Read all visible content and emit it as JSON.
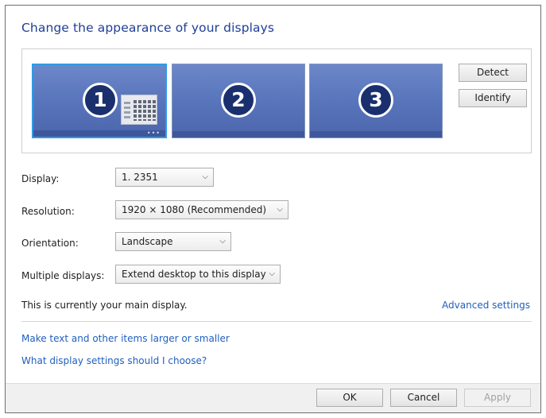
{
  "window": {
    "heading": "Change the appearance of your displays"
  },
  "monitors": [
    {
      "number": "1",
      "selected": true
    },
    {
      "number": "2",
      "selected": false
    },
    {
      "number": "3",
      "selected": false
    }
  ],
  "side_buttons": {
    "detect_label": "Detect",
    "identify_label": "Identify"
  },
  "form": {
    "display_label": "Display:",
    "display_value": "1. 2351",
    "resolution_label": "Resolution:",
    "resolution_value": "1920 × 1080 (Recommended)",
    "orientation_label": "Orientation:",
    "orientation_value": "Landscape",
    "multiple_label": "Multiple displays:",
    "multiple_value": "Extend desktop to this display"
  },
  "status": {
    "main_display_text": "This is currently your main display.",
    "advanced_link": "Advanced settings"
  },
  "links": {
    "text_size": "Make text and other items larger or smaller",
    "which_settings": "What display settings should I choose?"
  },
  "footer": {
    "ok_label": "OK",
    "cancel_label": "Cancel",
    "apply_label": "Apply"
  },
  "icons": {
    "dropdown": "chevron-down-icon",
    "start_tile": "start-screen-icon"
  },
  "colors": {
    "heading": "#1f3f97",
    "link": "#1f5fbf",
    "monitor": "#5773ba",
    "selected_border": "#2e9be6"
  }
}
